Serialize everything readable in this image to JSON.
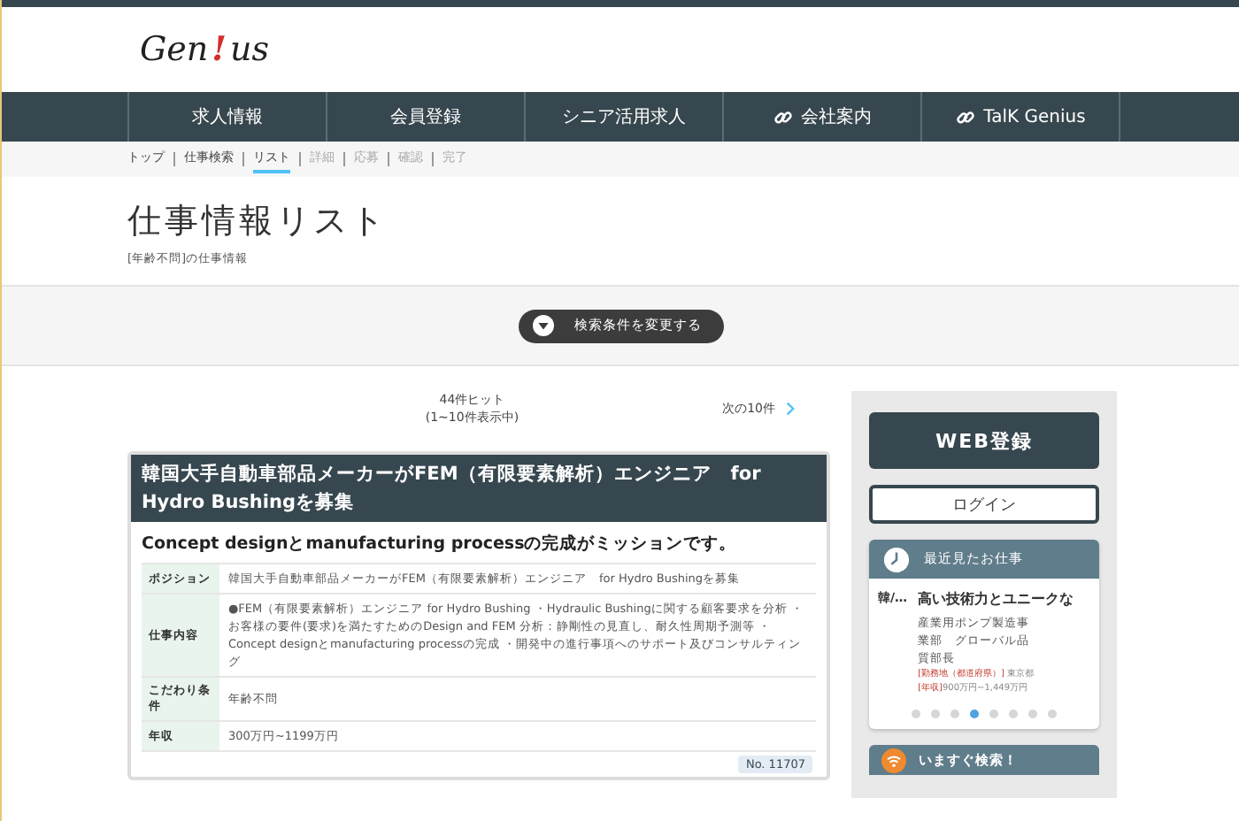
{
  "logo": {
    "parts": [
      {
        "text": "Gen",
        "accent": false
      },
      {
        "text": "!",
        "accent": true
      },
      {
        "text": "us",
        "accent": false
      }
    ]
  },
  "nav": [
    {
      "label": "求人情報",
      "kind": "plain"
    },
    {
      "label": "会員登録",
      "kind": "plain"
    },
    {
      "label": "シニア活用求人",
      "kind": "plain"
    },
    {
      "label": "会社案内",
      "kind": "link"
    },
    {
      "label": "TalK Genius",
      "kind": "link"
    }
  ],
  "breadcrumb": [
    {
      "label": "トップ",
      "selected": false,
      "disabled": false
    },
    {
      "label": "仕事検索",
      "selected": false,
      "disabled": false
    },
    {
      "label": "リスト",
      "selected": true,
      "disabled": false
    },
    {
      "label": "詳細",
      "selected": false,
      "disabled": true
    },
    {
      "label": "応募",
      "selected": false,
      "disabled": true
    },
    {
      "label": "確認",
      "selected": false,
      "disabled": true
    },
    {
      "label": "完了",
      "selected": false,
      "disabled": true
    }
  ],
  "page": {
    "title": "仕事情報リスト",
    "subtitle": "[年齢不問]の仕事情報"
  },
  "search_toggle": {
    "label": "検索条件を変更する"
  },
  "results": {
    "hits": "44件ヒット",
    "range": "(1~10件表示中)",
    "next": "次の10件"
  },
  "jobs": [
    {
      "title": "韓国大手自動車部品メーカーがFEM（有限要素解析）エンジニア　for Hydro Bushingを募集",
      "catch": "Concept designとmanufacturing processの完成がミッションです。",
      "fields": [
        {
          "label": "ポジション",
          "value": "韓国大手自動車部品メーカーがFEM（有限要素解析）エンジニア　for Hydro Bushingを募集"
        },
        {
          "label": "仕事内容",
          "value": "●FEM（有限要素解析）エンジニア for Hydro Bushing ・Hydraulic Bushingに関する顧客要求を分析 ・お客様の要件(要求)を満たすためのDesign and FEM 分析：静剛性の見直し、耐久性周期予測等 ・Concept designとmanufacturing processの完成 ・開発中の進行事項へのサポート及びコンサルティング"
        },
        {
          "label": "こだわり条件",
          "value": "年齢不問"
        },
        {
          "label": "年収",
          "value": "300万円~1199万円"
        }
      ],
      "number": "No. 11707"
    }
  ],
  "sidebar": {
    "register": "WEB登録",
    "login": "ログイン",
    "recent": {
      "title": "最近見たお仕事",
      "prev_title": "韓/…",
      "job_title": "高い技術力とユニークな",
      "lines": [
        "産業用ポンプ製造事業部　グローバル品質部長"
      ],
      "location_label": "[勤務地（都道府県）]",
      "location": "東京都",
      "salary_label": "[年収]",
      "salary": "900万円~1,449万円",
      "dots": [
        {
          "selected": false
        },
        {
          "selected": false
        },
        {
          "selected": false
        },
        {
          "selected": true
        },
        {
          "selected": false
        },
        {
          "selected": false
        },
        {
          "selected": false
        },
        {
          "selected": false
        }
      ]
    },
    "search_now": "いますぐ検索！"
  }
}
